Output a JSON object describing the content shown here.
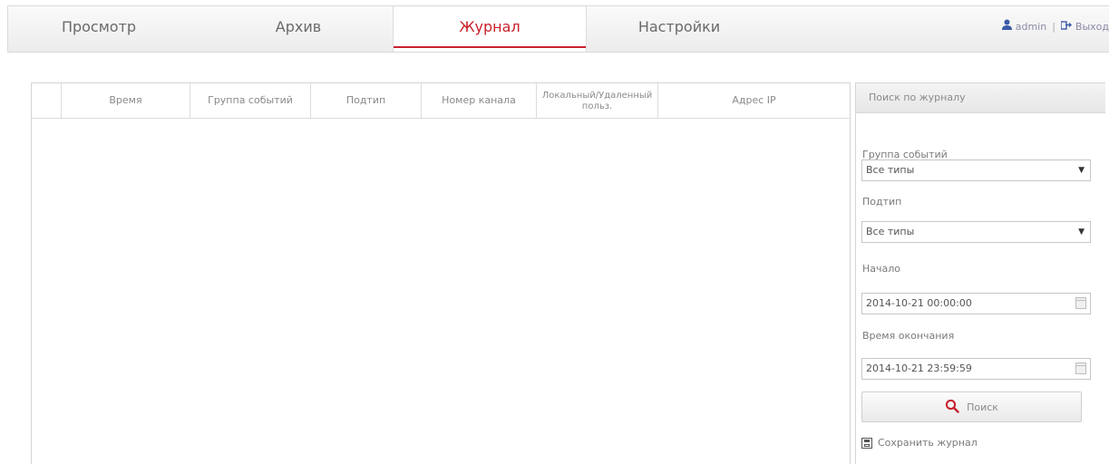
{
  "nav": {
    "tabs": [
      {
        "label": "Просмотр",
        "active": false
      },
      {
        "label": "Архив",
        "active": false
      },
      {
        "label": "Журнал",
        "active": true
      },
      {
        "label": "Настройки",
        "active": false
      }
    ],
    "user": "admin",
    "separator": "|",
    "logout": "Выход"
  },
  "table": {
    "columns": [
      "",
      "Время",
      "Группа событий",
      "Подтип",
      "Номер канала",
      "Локальный/Удаленный польз.",
      "Адрес IP"
    ],
    "rows": []
  },
  "search": {
    "title": "Поиск по журналу",
    "event_group_label": "Группа событий",
    "event_group_value": "Все типы",
    "subtype_label": "Подтип",
    "subtype_value": "Все типы",
    "start_label": "Начало",
    "start_value": "2014-10-21 00:00:00",
    "end_label": "Время окончания",
    "end_value": "2014-10-21 23:59:59",
    "search_button": "Поиск",
    "save_log": "Сохранить журнал"
  },
  "colors": {
    "accent": "#c8202c",
    "user_text": "#8a8aa6"
  }
}
